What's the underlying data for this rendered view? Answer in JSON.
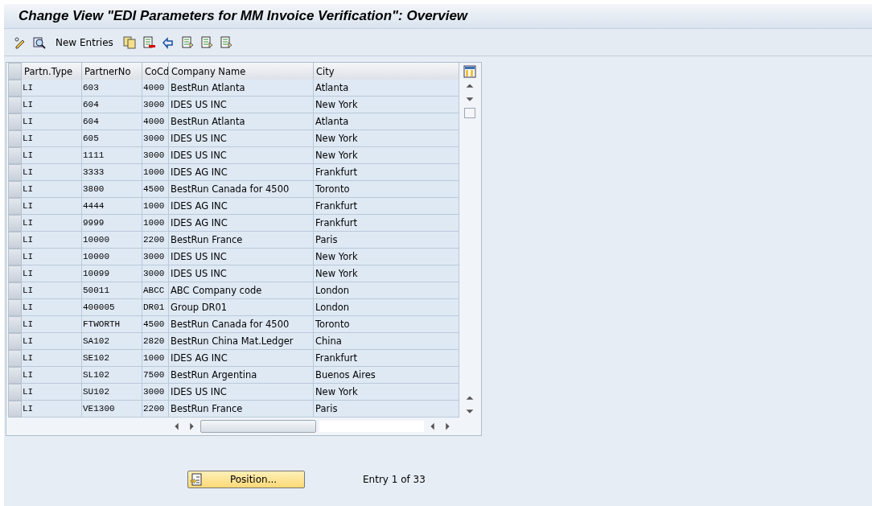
{
  "window": {
    "title": "Change View \"EDI Parameters for MM Invoice Verification\": Overview"
  },
  "toolbar": {
    "new_entries": "New Entries"
  },
  "table": {
    "columns": [
      "Partn.Type",
      "PartnerNo",
      "CoCd",
      "Company Name",
      "City"
    ],
    "rows": [
      [
        "LI",
        "603",
        "4000",
        "BestRun Atlanta",
        "Atlanta"
      ],
      [
        "LI",
        "604",
        "3000",
        "IDES US INC",
        "New York"
      ],
      [
        "LI",
        "604",
        "4000",
        "BestRun Atlanta",
        "Atlanta"
      ],
      [
        "LI",
        "605",
        "3000",
        "IDES US INC",
        "New York"
      ],
      [
        "LI",
        "1111",
        "3000",
        "IDES US INC",
        "New York"
      ],
      [
        "LI",
        "3333",
        "1000",
        "IDES AG INC",
        "Frankfurt"
      ],
      [
        "LI",
        "3800",
        "4500",
        "BestRun Canada for 4500",
        "Toronto"
      ],
      [
        "LI",
        "4444",
        "1000",
        "IDES AG INC",
        "Frankfurt"
      ],
      [
        "LI",
        "9999",
        "1000",
        "IDES AG INC",
        "Frankfurt"
      ],
      [
        "LI",
        "10000",
        "2200",
        "BestRun France",
        "Paris"
      ],
      [
        "LI",
        "10000",
        "3000",
        "IDES US INC",
        "New York"
      ],
      [
        "LI",
        "10099",
        "3000",
        "IDES US INC",
        "New York"
      ],
      [
        "LI",
        "50011",
        "ABCC",
        "ABC Company code",
        "London"
      ],
      [
        "LI",
        "400005",
        "DR01",
        "Group DR01",
        "London"
      ],
      [
        "LI",
        "FTWORTH",
        "4500",
        "BestRun Canada for 4500",
        "Toronto"
      ],
      [
        "LI",
        "SA102",
        "2820",
        "BestRun China Mat.Ledger",
        "China"
      ],
      [
        "LI",
        "SE102",
        "1000",
        "IDES AG INC",
        "Frankfurt"
      ],
      [
        "LI",
        "SL102",
        "7500",
        "BestRun Argentina",
        "Buenos Aires"
      ],
      [
        "LI",
        "SU102",
        "3000",
        "IDES US INC",
        "New York"
      ],
      [
        "LI",
        "VE1300",
        "2200",
        "BestRun France",
        "Paris"
      ]
    ]
  },
  "footer": {
    "position_button": "Position...",
    "entry_info": "Entry 1 of 33"
  }
}
